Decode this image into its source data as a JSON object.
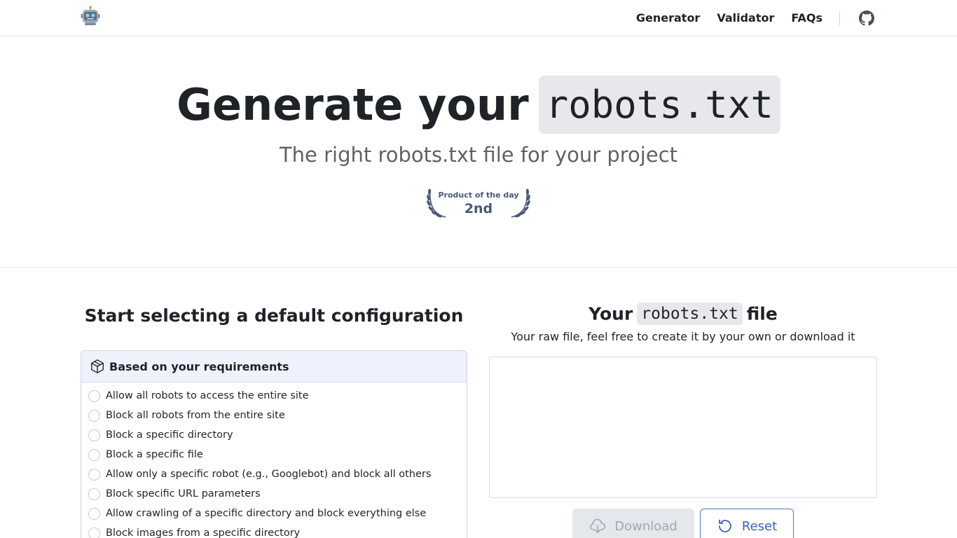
{
  "header": {
    "logo_icon": "robot-icon",
    "nav": [
      {
        "label": "Generator"
      },
      {
        "label": "Validator"
      },
      {
        "label": "FAQs"
      }
    ],
    "github_icon": "github-icon"
  },
  "hero": {
    "title_prefix": "Generate your",
    "title_code": "robots.txt",
    "subtitle": "The right robots.txt file for your project",
    "badge": {
      "label": "Product of the day",
      "rank": "2nd",
      "color": "#4b587c"
    }
  },
  "config": {
    "heading": "Start selecting a default configuration",
    "panel_title": "Based on your requirements",
    "panel_icon": "box-icon",
    "options": [
      {
        "label": "Allow all robots to access the entire site"
      },
      {
        "label": "Block all robots from the entire site"
      },
      {
        "label": "Block a specific directory"
      },
      {
        "label": "Block a specific file"
      },
      {
        "label": "Allow only a specific robot (e.g., Googlebot) and block all others"
      },
      {
        "label": "Block specific URL parameters"
      },
      {
        "label": "Allow crawling of a specific directory and block everything else"
      },
      {
        "label": "Block images from a specific directory"
      }
    ]
  },
  "output": {
    "heading_prefix": "Your",
    "heading_code": "robots.txt",
    "heading_suffix": "file",
    "subtitle": "Your raw file, feel free to create it by your own or download it",
    "raw_value": "",
    "download_label": "Download",
    "download_icon": "cloud-download-icon",
    "reset_label": "Reset",
    "reset_icon": "reset-icon",
    "accent_color": "#3b62b8"
  }
}
